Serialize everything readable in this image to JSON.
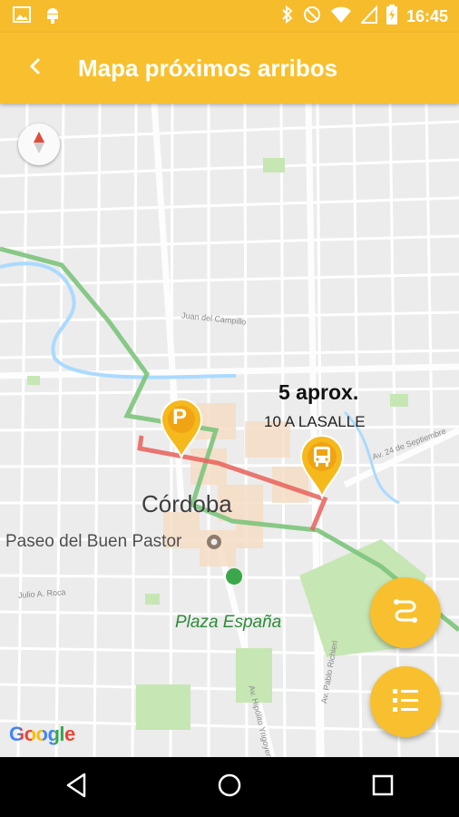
{
  "status_bar": {
    "time": "16:45",
    "icons": [
      "image-icon",
      "android-icon",
      "bluetooth-icon",
      "do-not-disturb-icon",
      "wifi-icon",
      "signal-icon",
      "battery-charging-icon"
    ]
  },
  "app_bar": {
    "title": "Mapa próximos arribos",
    "back_icon": "back-arrow-icon"
  },
  "map": {
    "city_label": "Córdoba",
    "poi_label": "Paseo del Buen Pastor",
    "plaza_label": "Plaza España",
    "arrival": {
      "time_text": "5 aprox.",
      "bus_label": "10 A LASALLE"
    },
    "parking_pin_letter": "P",
    "street_labels": [
      "Juan del Campillo",
      "Julio A. Roca",
      "Av. 24 de Septiembre",
      "Av. Pablo Richieri",
      "Av. Hipólito Yrigoyen"
    ],
    "colors": {
      "route_green": "#7cc47c",
      "route_red": "#e8615b",
      "accent": "#f8c02e"
    }
  },
  "fabs": {
    "route_icon": "route-icon",
    "list_icon": "list-icon"
  },
  "attribution": {
    "google": "Google"
  },
  "nav_bar": {
    "icons": [
      "back-triangle-icon",
      "home-circle-icon",
      "recents-square-icon"
    ]
  }
}
